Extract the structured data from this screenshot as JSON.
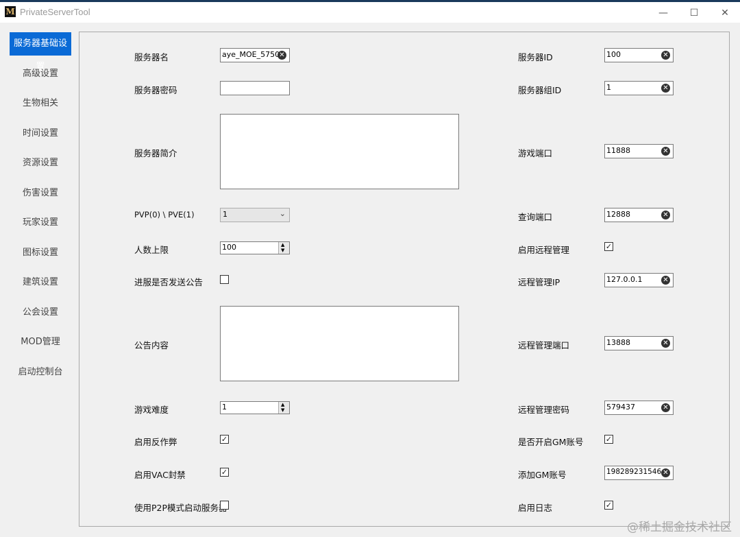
{
  "window": {
    "title": "PrivateServerTool",
    "icon_glyph": "M",
    "minimize_glyph": "—",
    "maximize_glyph": "☐",
    "close_glyph": "✕"
  },
  "sidebar": {
    "items": [
      {
        "label": "服务器基础设置",
        "active": true
      },
      {
        "label": "高级设置"
      },
      {
        "label": "生物相关"
      },
      {
        "label": "时间设置"
      },
      {
        "label": "资源设置"
      },
      {
        "label": "伤害设置"
      },
      {
        "label": "玩家设置"
      },
      {
        "label": "图标设置"
      },
      {
        "label": "建筑设置"
      },
      {
        "label": "公会设置"
      },
      {
        "label": "MOD管理"
      },
      {
        "label": "启动控制台"
      }
    ]
  },
  "form": {
    "server_name": {
      "label": "服务器名",
      "value": "aye_MOE_5750"
    },
    "server_password": {
      "label": "服务器密码",
      "value": ""
    },
    "server_desc": {
      "label": "服务器简介",
      "value": ""
    },
    "pvp_pve": {
      "label": "PVP(0) \\ PVE(1)",
      "value": "1"
    },
    "max_players": {
      "label": "人数上限",
      "value": "100"
    },
    "join_announce": {
      "label": "进服是否发送公告",
      "checked": false
    },
    "announce_content": {
      "label": "公告内容",
      "value": ""
    },
    "difficulty": {
      "label": "游戏难度",
      "value": "1"
    },
    "anti_cheat": {
      "label": "启用反作弊",
      "checked": true
    },
    "vac_ban": {
      "label": "启用VAC封禁",
      "checked": true
    },
    "p2p_mode": {
      "label": "使用P2P模式启动服务器",
      "checked": false
    },
    "server_id": {
      "label": "服务器ID",
      "value": "100"
    },
    "server_group_id": {
      "label": "服务器组ID",
      "value": "1"
    },
    "game_port": {
      "label": "游戏端口",
      "value": "11888"
    },
    "query_port": {
      "label": "查询端口",
      "value": "12888"
    },
    "rcon_enabled": {
      "label": "启用远程管理",
      "checked": true
    },
    "rcon_ip": {
      "label": "远程管理IP",
      "value": "127.0.0.1"
    },
    "rcon_port": {
      "label": "远程管理端口",
      "value": "13888"
    },
    "rcon_password": {
      "label": "远程管理密码",
      "value": "579437"
    },
    "gm_enabled": {
      "label": "是否开启GM账号",
      "checked": true
    },
    "gm_add": {
      "label": "添加GM账号",
      "value": "198289231546"
    },
    "log_enabled": {
      "label": "启用日志",
      "checked": true
    }
  },
  "glyphs": {
    "clear": "✕",
    "check": "✓",
    "dropdown": "⌄",
    "spin_up": "▲",
    "spin_down": "▼"
  },
  "watermark": "@稀土掘金技术社区"
}
